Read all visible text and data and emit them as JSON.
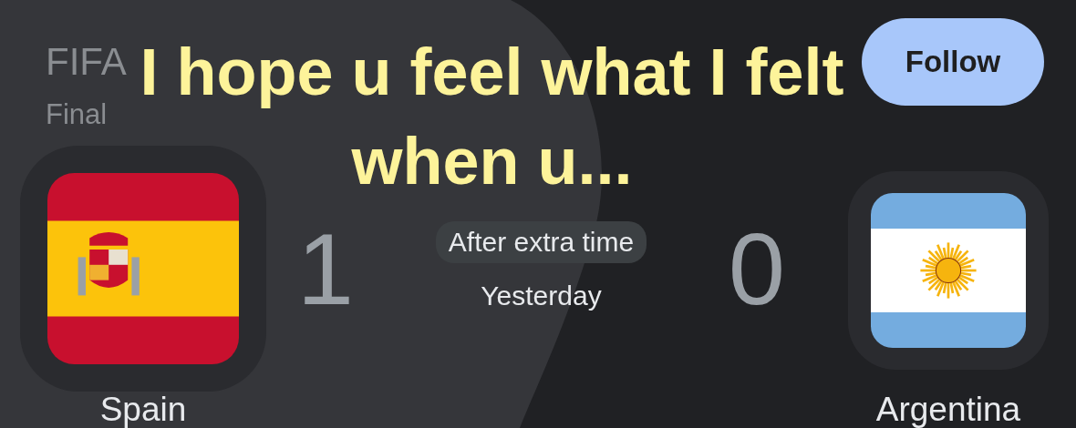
{
  "competition": {
    "title": "FIFA",
    "stage": "Final"
  },
  "follow_button": {
    "label": "Follow"
  },
  "match": {
    "home": {
      "name": "Spain",
      "score": "1"
    },
    "status": "After extra time",
    "date": "Yesterday",
    "away": {
      "name": "Argentina",
      "score": "0"
    }
  },
  "caption": {
    "text": "I hope u feel what I felt when u..."
  }
}
